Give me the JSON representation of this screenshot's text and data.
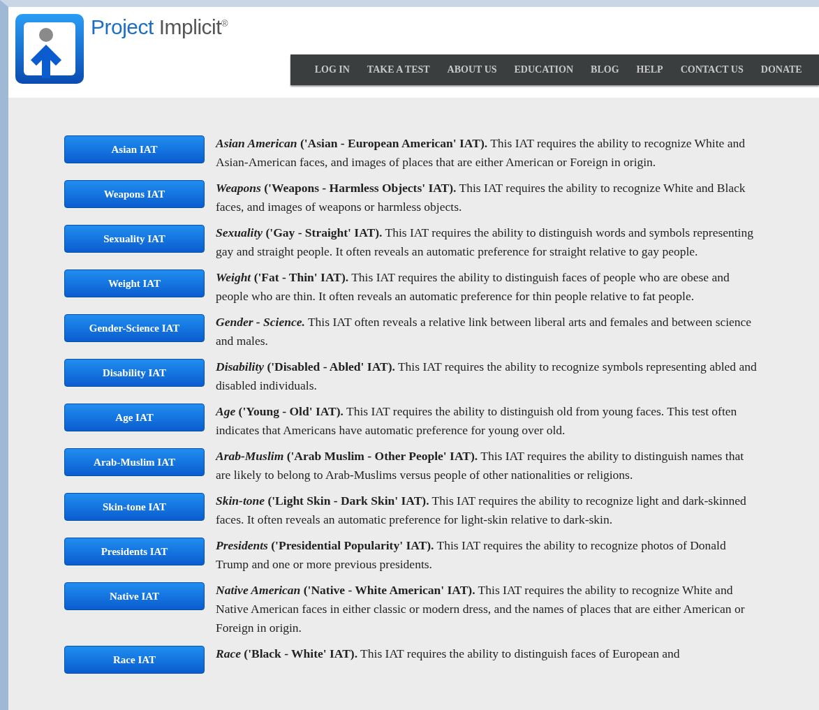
{
  "brand": {
    "name_part1": "Project",
    "name_part2": "Implicit",
    "mark": "®"
  },
  "nav": [
    "LOG IN",
    "TAKE A TEST",
    "ABOUT US",
    "EDUCATION",
    "BLOG",
    "HELP",
    "CONTACT US",
    "DONATE"
  ],
  "tests": [
    {
      "button": "Asian IAT",
      "name": "Asian American",
      "label": "('Asian - European American' IAT).",
      "text": "This IAT requires the ability to recognize White and Asian-American faces, and images of places that are either American or Foreign in origin."
    },
    {
      "button": "Weapons IAT",
      "name": "Weapons",
      "label": "('Weapons - Harmless Objects' IAT).",
      "text": "This IAT requires the ability to recognize White and Black faces, and images of weapons or harmless objects."
    },
    {
      "button": "Sexuality IAT",
      "name": "Sexuality",
      "label": "('Gay - Straight' IAT).",
      "text": "This IAT requires the ability to distinguish words and symbols representing gay and straight people. It often reveals an automatic preference for straight relative to gay people."
    },
    {
      "button": "Weight IAT",
      "name": "Weight",
      "label": "('Fat - Thin' IAT).",
      "text": "This IAT requires the ability to distinguish faces of people who are obese and people who are thin. It often reveals an automatic preference for thin people relative to fat people."
    },
    {
      "button": "Gender-Science IAT",
      "name": "Gender - Science.",
      "text": "This IAT often reveals a relative link between liberal arts and females and between science and males."
    },
    {
      "button": "Disability IAT",
      "name": "Disability",
      "label": "('Disabled - Abled' IAT).",
      "text": "This IAT requires the ability to recognize symbols representing abled and disabled individuals."
    },
    {
      "button": "Age IAT",
      "name": "Age",
      "label": "('Young - Old' IAT).",
      "text": "This IAT requires the ability to distinguish old from young faces. This test often indicates that Americans have automatic preference for young over old."
    },
    {
      "button": "Arab-Muslim IAT",
      "name": "Arab-Muslim",
      "label": "('Arab Muslim - Other People' IAT).",
      "text": "This IAT requires the ability to distinguish names that are likely to belong to Arab-Muslims versus people of other nationalities or religions."
    },
    {
      "button": "Skin-tone IAT",
      "name": "Skin-tone",
      "label": "('Light Skin - Dark Skin' IAT).",
      "text": "This IAT requires the ability to recognize light and dark-skinned faces. It often reveals an automatic preference for light-skin relative to dark-skin."
    },
    {
      "button": "Presidents IAT",
      "name": "Presidents",
      "label": "('Presidential Popularity' IAT).",
      "text": "This IAT requires the ability to recognize photos of Donald Trump and one or more previous presidents."
    },
    {
      "button": "Native IAT",
      "name": "Native American",
      "label": "('Native - White American' IAT).",
      "text": "This IAT requires the ability to recognize White and Native American faces in either classic or modern dress, and the names of places that are either American or Foreign in origin."
    },
    {
      "button": "Race IAT",
      "name": "Race",
      "label": "('Black - White' IAT).",
      "text": "This IAT requires the ability to distinguish faces of European and"
    }
  ]
}
